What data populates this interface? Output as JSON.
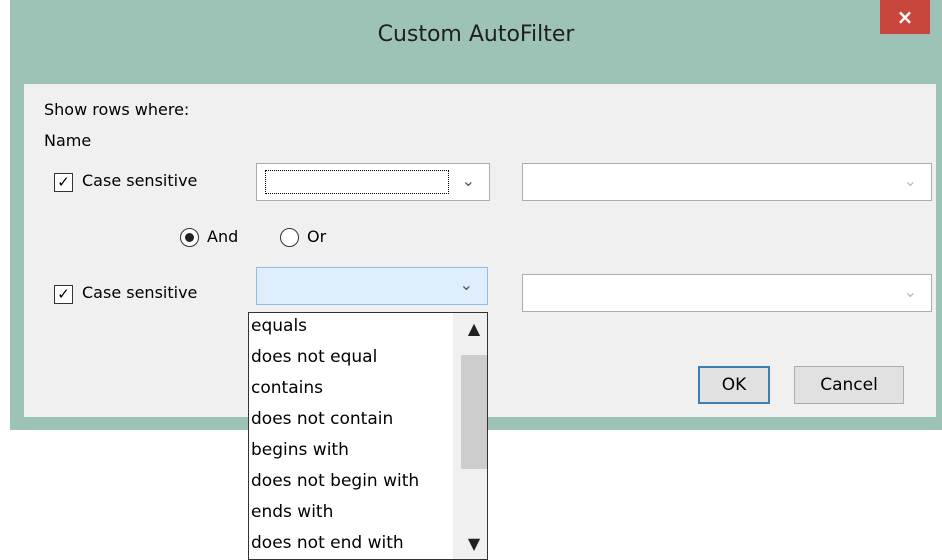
{
  "dialog": {
    "title": "Custom AutoFilter",
    "close_label": "×",
    "show_rows_label": "Show rows where:",
    "field_name": "Name",
    "criteria1": {
      "case_sensitive_label": "Case sensitive",
      "case_sensitive_checked": "✓",
      "operator_value": "",
      "value": ""
    },
    "logic": {
      "and_label": "And",
      "or_label": "Or",
      "selected": "And"
    },
    "criteria2": {
      "case_sensitive_label": "Case sensitive",
      "case_sensitive_checked": "✓",
      "operator_value": "",
      "value": ""
    },
    "ok_label": "OK",
    "cancel_label": "Cancel"
  },
  "dropdown": {
    "items": [
      "equals",
      "does not equal",
      "contains",
      "does not contain",
      "begins with",
      "does not begin with",
      "ends with",
      "does not end with"
    ]
  },
  "icons": {
    "chevron": "⌄"
  }
}
